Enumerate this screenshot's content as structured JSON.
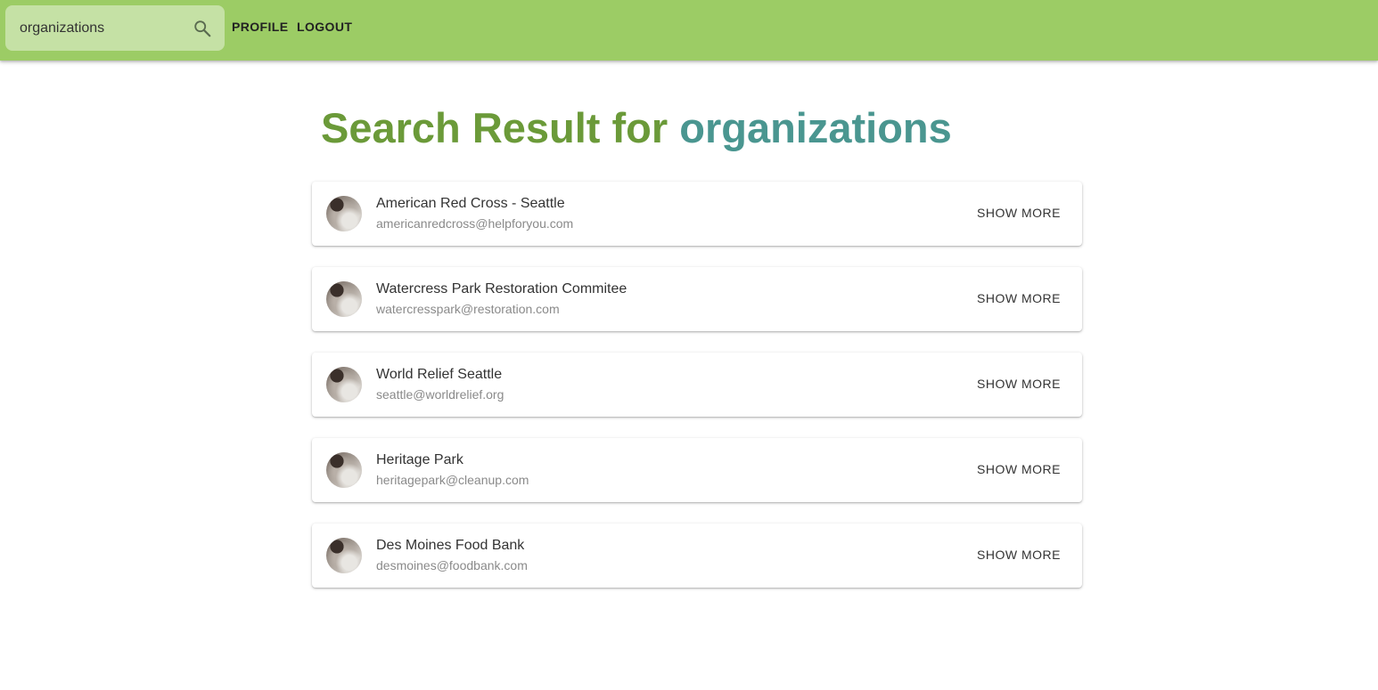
{
  "header": {
    "search": {
      "value": "organizations",
      "icon": "search-icon"
    },
    "nav": {
      "profile_label": "PROFILE",
      "logout_label": "LOGOUT"
    },
    "colors": {
      "appbar": "#9ccc65",
      "search_bg": "#c5e1a5"
    }
  },
  "main": {
    "title_prefix": "Search Result for ",
    "title_query": "organizations",
    "colors": {
      "title_prefix": "#6b9a39",
      "title_query": "#4a9690"
    },
    "results": [
      {
        "name": "American Red Cross - Seattle",
        "email": "americanredcross@helpforyou.com",
        "action_label": "SHOW MORE"
      },
      {
        "name": "Watercress Park Restoration Commitee",
        "email": "watercresspark@restoration.com",
        "action_label": "SHOW MORE"
      },
      {
        "name": "World Relief Seattle",
        "email": "seattle@worldrelief.org",
        "action_label": "SHOW MORE"
      },
      {
        "name": "Heritage Park",
        "email": "heritagepark@cleanup.com",
        "action_label": "SHOW MORE"
      },
      {
        "name": "Des Moines Food Bank",
        "email": "desmoines@foodbank.com",
        "action_label": "SHOW MORE"
      }
    ]
  }
}
